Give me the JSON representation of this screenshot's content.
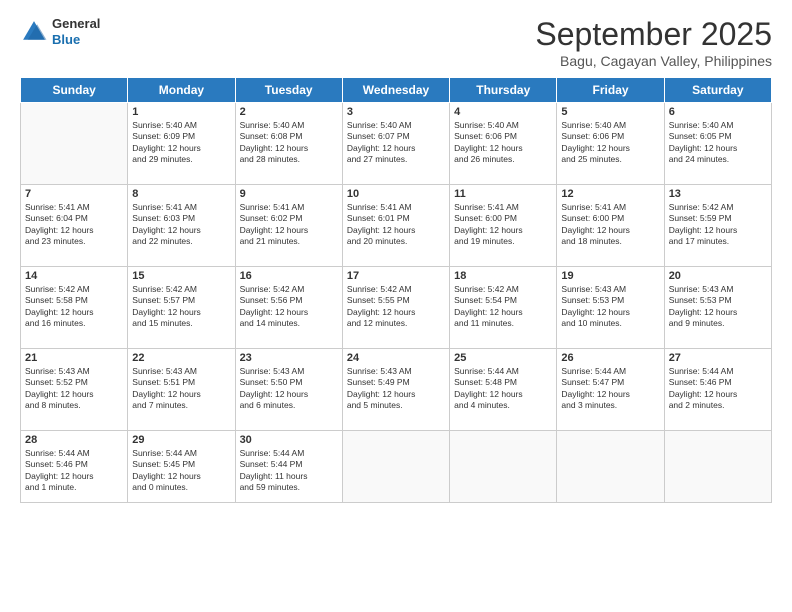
{
  "logo": {
    "line1": "General",
    "line2": "Blue"
  },
  "title": "September 2025",
  "subtitle": "Bagu, Cagayan Valley, Philippines",
  "headers": [
    "Sunday",
    "Monday",
    "Tuesday",
    "Wednesday",
    "Thursday",
    "Friday",
    "Saturday"
  ],
  "weeks": [
    [
      {
        "day": "",
        "text": ""
      },
      {
        "day": "1",
        "text": "Sunrise: 5:40 AM\nSunset: 6:09 PM\nDaylight: 12 hours\nand 29 minutes."
      },
      {
        "day": "2",
        "text": "Sunrise: 5:40 AM\nSunset: 6:08 PM\nDaylight: 12 hours\nand 28 minutes."
      },
      {
        "day": "3",
        "text": "Sunrise: 5:40 AM\nSunset: 6:07 PM\nDaylight: 12 hours\nand 27 minutes."
      },
      {
        "day": "4",
        "text": "Sunrise: 5:40 AM\nSunset: 6:06 PM\nDaylight: 12 hours\nand 26 minutes."
      },
      {
        "day": "5",
        "text": "Sunrise: 5:40 AM\nSunset: 6:06 PM\nDaylight: 12 hours\nand 25 minutes."
      },
      {
        "day": "6",
        "text": "Sunrise: 5:40 AM\nSunset: 6:05 PM\nDaylight: 12 hours\nand 24 minutes."
      }
    ],
    [
      {
        "day": "7",
        "text": "Sunrise: 5:41 AM\nSunset: 6:04 PM\nDaylight: 12 hours\nand 23 minutes."
      },
      {
        "day": "8",
        "text": "Sunrise: 5:41 AM\nSunset: 6:03 PM\nDaylight: 12 hours\nand 22 minutes."
      },
      {
        "day": "9",
        "text": "Sunrise: 5:41 AM\nSunset: 6:02 PM\nDaylight: 12 hours\nand 21 minutes."
      },
      {
        "day": "10",
        "text": "Sunrise: 5:41 AM\nSunset: 6:01 PM\nDaylight: 12 hours\nand 20 minutes."
      },
      {
        "day": "11",
        "text": "Sunrise: 5:41 AM\nSunset: 6:00 PM\nDaylight: 12 hours\nand 19 minutes."
      },
      {
        "day": "12",
        "text": "Sunrise: 5:41 AM\nSunset: 6:00 PM\nDaylight: 12 hours\nand 18 minutes."
      },
      {
        "day": "13",
        "text": "Sunrise: 5:42 AM\nSunset: 5:59 PM\nDaylight: 12 hours\nand 17 minutes."
      }
    ],
    [
      {
        "day": "14",
        "text": "Sunrise: 5:42 AM\nSunset: 5:58 PM\nDaylight: 12 hours\nand 16 minutes."
      },
      {
        "day": "15",
        "text": "Sunrise: 5:42 AM\nSunset: 5:57 PM\nDaylight: 12 hours\nand 15 minutes."
      },
      {
        "day": "16",
        "text": "Sunrise: 5:42 AM\nSunset: 5:56 PM\nDaylight: 12 hours\nand 14 minutes."
      },
      {
        "day": "17",
        "text": "Sunrise: 5:42 AM\nSunset: 5:55 PM\nDaylight: 12 hours\nand 12 minutes."
      },
      {
        "day": "18",
        "text": "Sunrise: 5:42 AM\nSunset: 5:54 PM\nDaylight: 12 hours\nand 11 minutes."
      },
      {
        "day": "19",
        "text": "Sunrise: 5:43 AM\nSunset: 5:53 PM\nDaylight: 12 hours\nand 10 minutes."
      },
      {
        "day": "20",
        "text": "Sunrise: 5:43 AM\nSunset: 5:53 PM\nDaylight: 12 hours\nand 9 minutes."
      }
    ],
    [
      {
        "day": "21",
        "text": "Sunrise: 5:43 AM\nSunset: 5:52 PM\nDaylight: 12 hours\nand 8 minutes."
      },
      {
        "day": "22",
        "text": "Sunrise: 5:43 AM\nSunset: 5:51 PM\nDaylight: 12 hours\nand 7 minutes."
      },
      {
        "day": "23",
        "text": "Sunrise: 5:43 AM\nSunset: 5:50 PM\nDaylight: 12 hours\nand 6 minutes."
      },
      {
        "day": "24",
        "text": "Sunrise: 5:43 AM\nSunset: 5:49 PM\nDaylight: 12 hours\nand 5 minutes."
      },
      {
        "day": "25",
        "text": "Sunrise: 5:44 AM\nSunset: 5:48 PM\nDaylight: 12 hours\nand 4 minutes."
      },
      {
        "day": "26",
        "text": "Sunrise: 5:44 AM\nSunset: 5:47 PM\nDaylight: 12 hours\nand 3 minutes."
      },
      {
        "day": "27",
        "text": "Sunrise: 5:44 AM\nSunset: 5:46 PM\nDaylight: 12 hours\nand 2 minutes."
      }
    ],
    [
      {
        "day": "28",
        "text": "Sunrise: 5:44 AM\nSunset: 5:46 PM\nDaylight: 12 hours\nand 1 minute."
      },
      {
        "day": "29",
        "text": "Sunrise: 5:44 AM\nSunset: 5:45 PM\nDaylight: 12 hours\nand 0 minutes."
      },
      {
        "day": "30",
        "text": "Sunrise: 5:44 AM\nSunset: 5:44 PM\nDaylight: 11 hours\nand 59 minutes."
      },
      {
        "day": "",
        "text": ""
      },
      {
        "day": "",
        "text": ""
      },
      {
        "day": "",
        "text": ""
      },
      {
        "day": "",
        "text": ""
      }
    ]
  ]
}
